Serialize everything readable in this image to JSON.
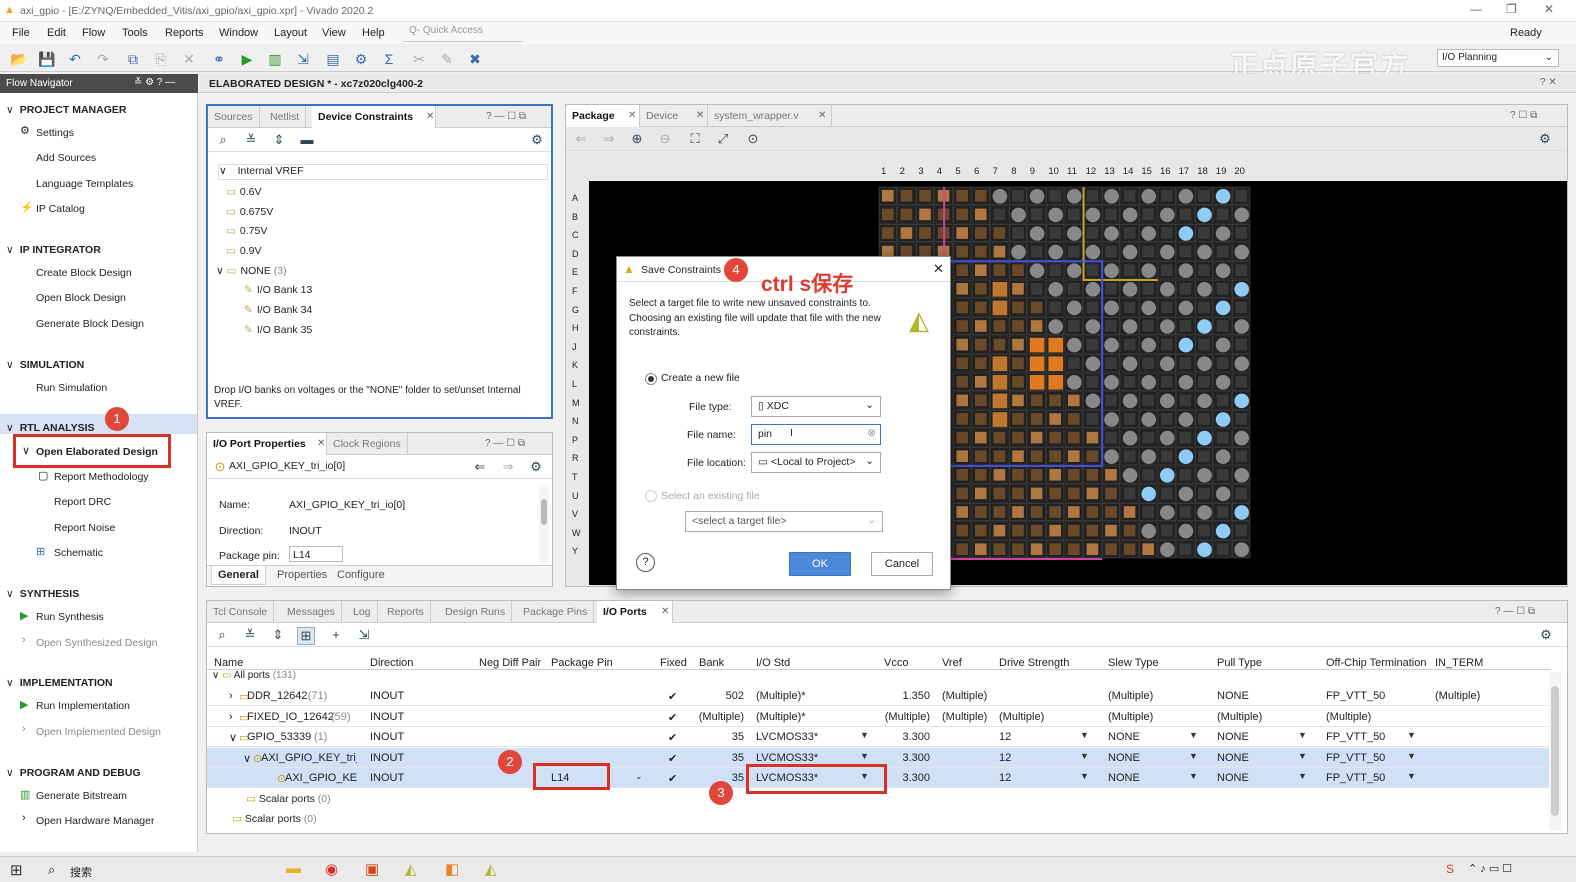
{
  "window": {
    "title": "axi_gpio - [E:/ZYNQ/Embedded_Vitis/axi_gpio/axi_gpio.xpr] - Vivado 2020.2",
    "status": "Ready"
  },
  "menu": [
    "File",
    "Edit",
    "Flow",
    "Tools",
    "Reports",
    "Window",
    "Layout",
    "View",
    "Help"
  ],
  "quick_access": "Q- Quick Access",
  "layout_select": "I/O Planning",
  "watermark": "正点原子官方",
  "flow_navigator": {
    "title": "Flow Navigator",
    "sections": {
      "project_manager": "PROJECT MANAGER",
      "ip_integrator": "IP INTEGRATOR",
      "simulation": "SIMULATION",
      "rtl_analysis": "RTL ANALYSIS",
      "synthesis": "SYNTHESIS",
      "implementation": "IMPLEMENTATION",
      "program_debug": "PROGRAM AND DEBUG"
    },
    "items": {
      "settings": "Settings",
      "add_sources": "Add Sources",
      "language_templates": "Language Templates",
      "ip_catalog": "IP Catalog",
      "create_bd": "Create Block Design",
      "open_bd": "Open Block Design",
      "generate_bd": "Generate Block Design",
      "run_sim": "Run Simulation",
      "open_elab": "Open Elaborated Design",
      "report_meth": "Report Methodology",
      "report_drc": "Report DRC",
      "report_noise": "Report Noise",
      "schematic": "Schematic",
      "run_synth": "Run Synthesis",
      "open_synth": "Open Synthesized Design",
      "run_impl": "Run Implementation",
      "open_impl": "Open Implemented Design",
      "gen_bitstream": "Generate Bitstream",
      "open_hw": "Open Hardware Manager"
    }
  },
  "design_header": "ELABORATED DESIGN * - xc7z020clg400-2",
  "device_constraints": {
    "tabs": [
      "Sources",
      "Netlist",
      "Device Constraints"
    ],
    "tree": {
      "root": "Internal VREF",
      "v1": "0.6V",
      "v2": "0.675V",
      "v3": "0.75V",
      "v4": "0.9V",
      "none": "NONE",
      "none_count": "(3)",
      "b13": "I/O Bank 13",
      "b34": "I/O Bank 34",
      "b35": "I/O Bank 35"
    },
    "hint": "Drop I/O banks on voltages or the \"NONE\" folder to set/unset Internal VREF."
  },
  "port_props": {
    "tabs": [
      "I/O Port Properties",
      "Clock Regions"
    ],
    "port": "AXI_GPIO_KEY_tri_io[0]",
    "name_label": "Name:",
    "name_value": "AXI_GPIO_KEY_tri_io[0]",
    "dir_label": "Direction:",
    "dir_value": "INOUT",
    "pin_label": "Package pin:",
    "pin_value": "L14",
    "bottom_tabs": [
      "General",
      "Properties",
      "Configure"
    ]
  },
  "package_view": {
    "tabs": [
      "Package",
      "Device",
      "system_wrapper.v"
    ],
    "cols": [
      "1",
      "2",
      "3",
      "4",
      "5",
      "6",
      "7",
      "8",
      "9",
      "10",
      "11",
      "12",
      "13",
      "14",
      "15",
      "16",
      "17",
      "18",
      "19",
      "20"
    ],
    "rows": [
      "A",
      "B",
      "C",
      "D",
      "E",
      "F",
      "G",
      "H",
      "J",
      "K",
      "L",
      "M",
      "N",
      "P",
      "R",
      "T",
      "U",
      "V",
      "W",
      "Y"
    ]
  },
  "dialog": {
    "title": "Save Constraints",
    "annotation": "ctrl s保存",
    "desc": "Select a target file to write new unsaved constraints to. Choosing an existing file will update that file with the new constraints.",
    "create_new": "Create a new file",
    "file_type_label": "File type:",
    "file_type": "XDC",
    "file_name_label": "File name:",
    "file_name": "pin",
    "file_loc_label": "File location:",
    "file_loc": "<Local to Project>",
    "select_existing": "Select an existing file",
    "select_target": "<select a target file>",
    "help": "?",
    "ok": "OK",
    "cancel": "Cancel"
  },
  "bottom_tabs": [
    "Tcl Console",
    "Messages",
    "Log",
    "Reports",
    "Design Runs",
    "Package Pins",
    "I/O Ports"
  ],
  "io_ports": {
    "headers": [
      "Name",
      "Direction",
      "Neg Diff Pair",
      "Package Pin",
      "Fixed",
      "Bank",
      "I/O Std",
      "Vcco",
      "Vref",
      "Drive Strength",
      "Slew Type",
      "Pull Type",
      "Off-Chip Termination",
      "IN_TERM"
    ],
    "all_ports": "All ports",
    "all_count": "(131)",
    "rows": [
      {
        "name": "DDR_12642",
        "count": "(71)",
        "dir": "INOUT",
        "pin": "",
        "fixed": "✔",
        "bank": "502",
        "std": "(Multiple)*",
        "vcco": "1.350",
        "vref": "(Multiple)",
        "drive": "",
        "slew": "(Multiple)",
        "pull": "NONE",
        "term": "FP_VTT_50",
        "interm": "(Multiple)"
      },
      {
        "name": "FIXED_IO_12642",
        "count": "(59)",
        "dir": "INOUT",
        "pin": "",
        "fixed": "✔",
        "bank": "(Multiple)",
        "std": "(Multiple)*",
        "vcco": "(Multiple)",
        "vref": "(Multiple)",
        "drive": "(Multiple)",
        "slew": "(Multiple)",
        "pull": "(Multiple)",
        "term": "(Multiple)",
        "interm": ""
      },
      {
        "name": "GPIO_53339",
        "count": "(1)",
        "dir": "INOUT",
        "pin": "",
        "fixed": "✔",
        "bank": "35",
        "std": "LVCMOS33*",
        "vcco": "3.300",
        "vref": "",
        "drive": "12",
        "slew": "NONE",
        "pull": "NONE",
        "term": "FP_VTT_50",
        "interm": ""
      },
      {
        "name": "AXI_GPIO_KEY_tri_io",
        "count": "",
        "dir": "INOUT",
        "pin": "",
        "fixed": "✔",
        "bank": "35",
        "std": "LVCMOS33*",
        "vcco": "3.300",
        "vref": "",
        "drive": "12",
        "slew": "NONE",
        "pull": "NONE",
        "term": "FP_VTT_50",
        "interm": ""
      },
      {
        "name": "AXI_GPIO_KEY_tri_io[0]",
        "count": "",
        "dir": "INOUT",
        "pin": "L14",
        "fixed": "✔",
        "bank": "35",
        "std": "LVCMOS33*",
        "vcco": "3.300",
        "vref": "",
        "drive": "12",
        "slew": "NONE",
        "pull": "NONE",
        "term": "FP_VTT_50",
        "interm": ""
      }
    ],
    "scalar1": "Scalar ports",
    "scalar1_count": "(0)",
    "scalar2": "Scalar ports",
    "scalar2_count": "(0)"
  },
  "badges": [
    "1",
    "2",
    "3",
    "4"
  ],
  "taskbar": {
    "search": "搜索"
  }
}
